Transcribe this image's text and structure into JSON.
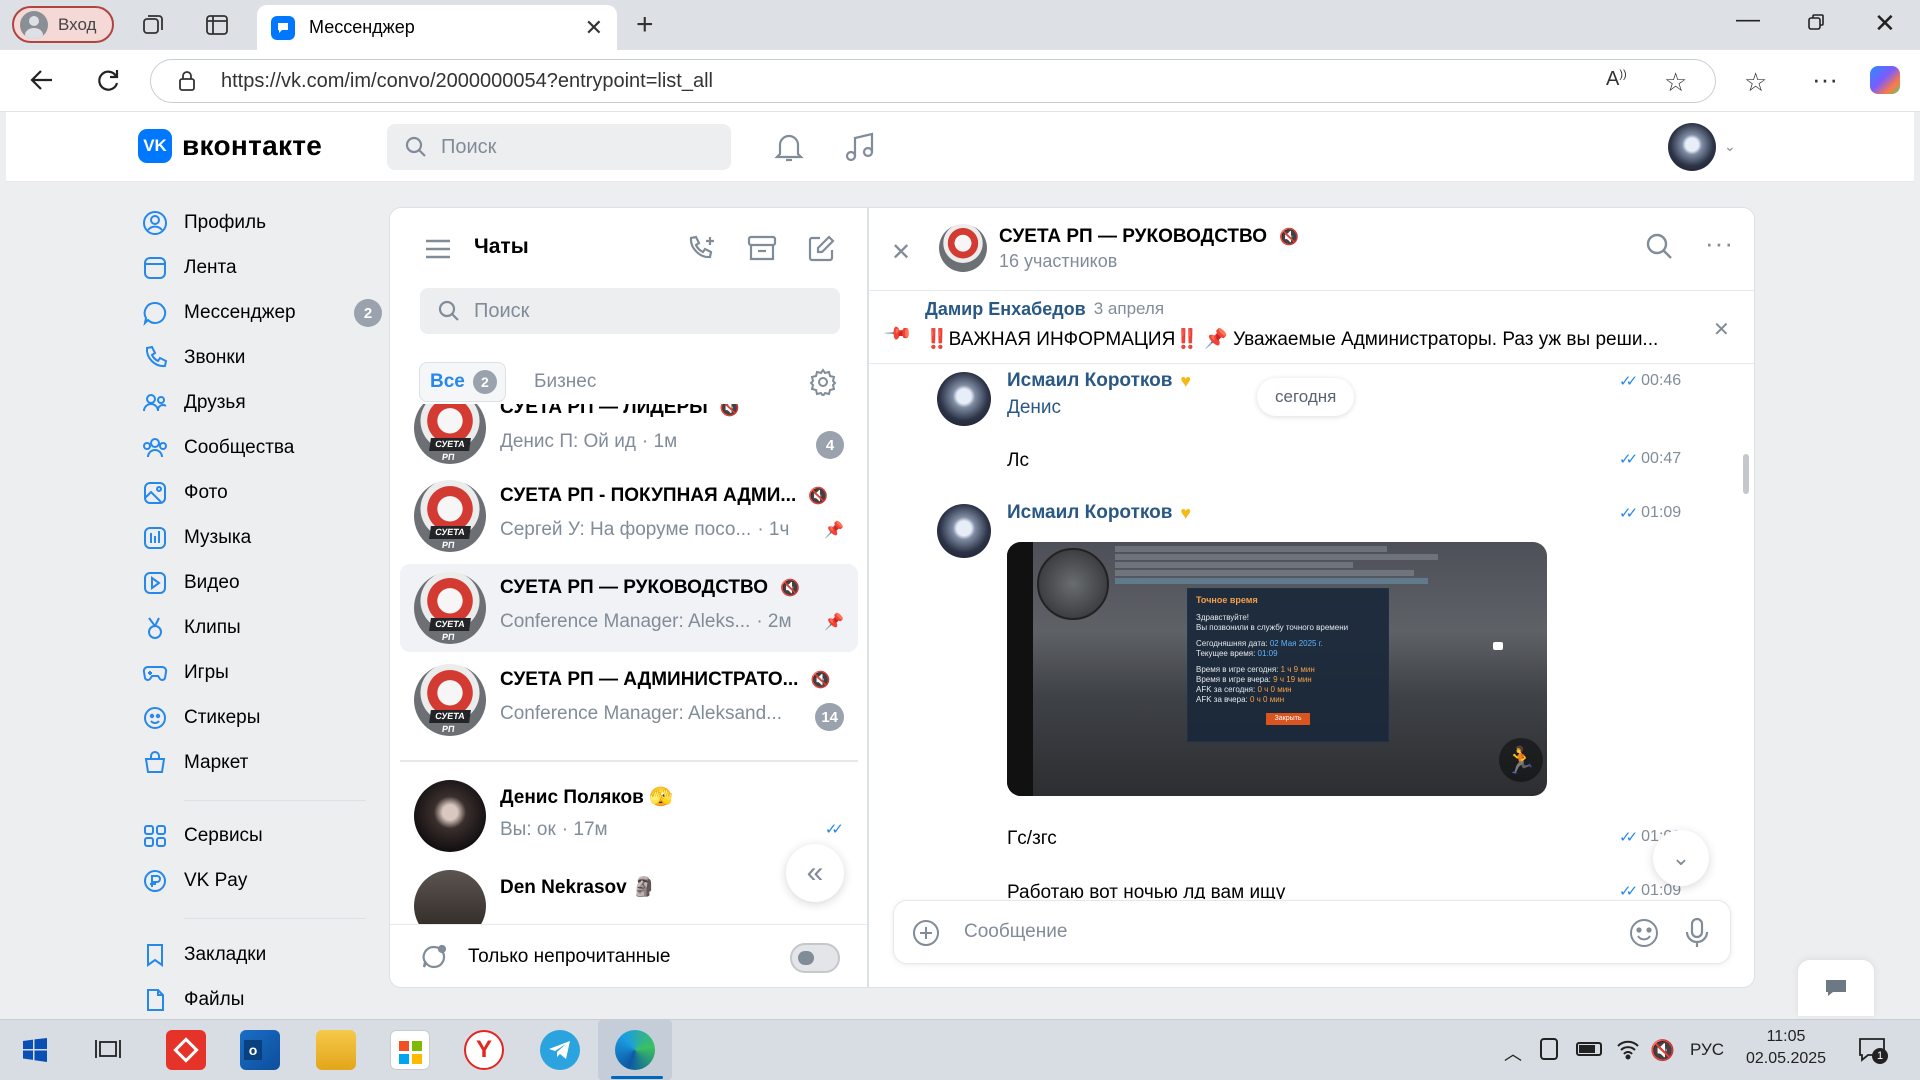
{
  "browser": {
    "login_label": "Вход",
    "tab_title": "Мессенджер",
    "url": "https://vk.com/im/convo/2000000054?entrypoint=list_all"
  },
  "vk": {
    "logo_text": "вконтакте",
    "search_placeholder": "Поиск"
  },
  "sidebar": {
    "items": [
      {
        "label": "Профиль",
        "icon": "profile-icon"
      },
      {
        "label": "Лента",
        "icon": "feed-icon"
      },
      {
        "label": "Мессенджер",
        "icon": "messenger-icon",
        "badge": "2"
      },
      {
        "label": "Звонки",
        "icon": "calls-icon"
      },
      {
        "label": "Друзья",
        "icon": "friends-icon"
      },
      {
        "label": "Сообщества",
        "icon": "communities-icon"
      },
      {
        "label": "Фото",
        "icon": "photo-icon"
      },
      {
        "label": "Музыка",
        "icon": "music-icon"
      },
      {
        "label": "Видео",
        "icon": "video-icon"
      },
      {
        "label": "Клипы",
        "icon": "clips-icon"
      },
      {
        "label": "Игры",
        "icon": "games-icon"
      },
      {
        "label": "Стикеры",
        "icon": "stickers-icon"
      },
      {
        "label": "Маркет",
        "icon": "market-icon"
      }
    ],
    "items2": [
      {
        "label": "Сервисы",
        "icon": "services-icon"
      },
      {
        "label": "VK Pay",
        "icon": "vkpay-icon"
      }
    ],
    "items3": [
      {
        "label": "Закладки",
        "icon": "bookmarks-icon"
      },
      {
        "label": "Файлы",
        "icon": "files-icon"
      }
    ]
  },
  "chats": {
    "title": "Чаты",
    "search_placeholder": "Поиск",
    "filter_all": "Все",
    "filter_all_count": "2",
    "filter_business": "Бизнес",
    "unread_only": "Только непрочитанные",
    "list": [
      {
        "title": "СУЕТА РП — ЛИДЕРЫ",
        "preview": "Денис П: Ой ид",
        "time": "· 1м",
        "unread": "4",
        "avatar_label": "СУЕТА РП"
      },
      {
        "title": "СУЕТА РП - ПОКУПНАЯ АДМИ...",
        "preview": "Сергей У: На форуме посо...",
        "time": "· 1ч",
        "avatar_label": "СУЕТА РП"
      },
      {
        "title": "СУЕТА РП — РУКОВОДСТВО",
        "preview": "Conference Manager: Aleks...",
        "time": "· 2м",
        "avatar_label": "СУЕТА РП"
      },
      {
        "title": "СУЕТА РП — АДМИНИСТРАТО...",
        "preview": "Conference Manager: Aleksand...",
        "unread": "14",
        "avatar_label": "СУЕТА РП"
      },
      {
        "title": "Денис Поляков",
        "preview": "Вы: ок",
        "time": "· 17м"
      },
      {
        "title": "Den Nekrasov"
      }
    ]
  },
  "conversation": {
    "title": "СУЕТА РП — РУКОВОДСТВО",
    "members": "16 участников",
    "pinned": {
      "author": "Дамир Енхабедов",
      "date": "3 апреля",
      "text": "‼️ВАЖНАЯ ИНФОРМАЦИЯ‼️ 📌 Уважаемые Администраторы. Раз уж вы реши..."
    },
    "date_chip": "сегодня",
    "messages": [
      {
        "author": "Исмаил Коротков",
        "text": "Денис",
        "time": "00:46"
      },
      {
        "text": "Лс",
        "time": "00:47"
      },
      {
        "author": "Исмаил Коротков",
        "time": "01:09"
      },
      {
        "text": "Гс/згс",
        "time": "01:09"
      },
      {
        "text": "Работаю вот ночью лд вам ищу",
        "time": "01:09"
      }
    ],
    "screenshot": {
      "dialog_title": "Точное время",
      "greeting": "Здравствуйте!",
      "line1": "Вы позвонили в службу точного времени",
      "date_label": "Сегодняшняя дата:",
      "date_value": "02 Мая 2025 г.",
      "time_label": "Текущее время:",
      "time_value": "01:09",
      "today_label": "Время в игре сегодня:",
      "today_value": "1 ч 9 мин",
      "yesterday_label": "Время в игре вчера:",
      "yesterday_value": "9 ч 19 мин",
      "afk_today_label": "AFK за сегодня:",
      "afk_today_value": "0 ч 0 мин",
      "afk_yesterday_label": "AFK за вчера:",
      "afk_yesterday_value": "0 ч 0 мин",
      "close_button": "Закрыть"
    },
    "composer_placeholder": "Сообщение"
  },
  "taskbar": {
    "lang": "РУС",
    "time": "11:05",
    "date": "02.05.2025",
    "notifications": "1"
  },
  "colors": {
    "accent": "#2688eb",
    "vk_logo": "#0077ff",
    "name_link": "#2a5885",
    "badge_gray": "#99a2ad"
  }
}
